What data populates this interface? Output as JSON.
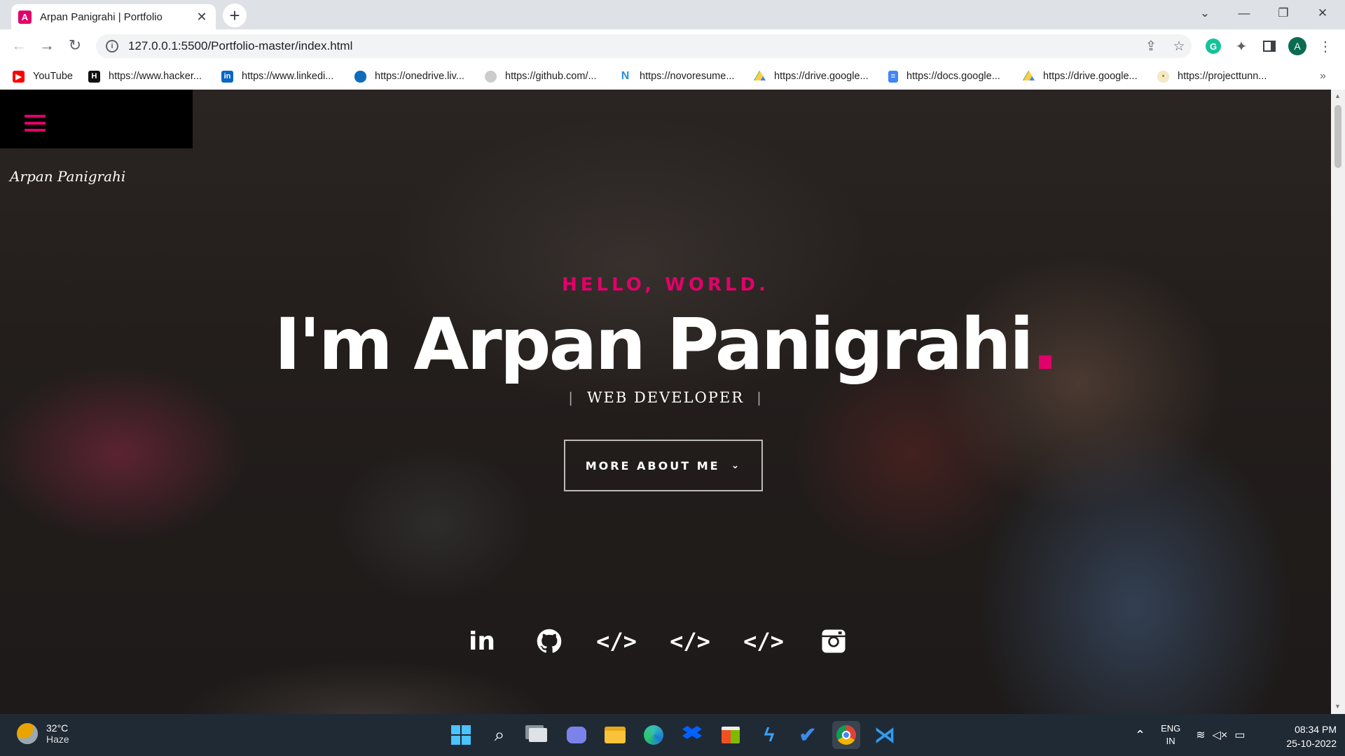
{
  "browser": {
    "tab_title": "Arpan Panigrahi | Portfolio",
    "tab_favicon": "A",
    "url": "127.0.0.1:5500/Portfolio-master/index.html",
    "profile_initial": "A",
    "bookmarks": [
      {
        "label": "YouTube",
        "icon": "youtube-icon"
      },
      {
        "label": "https://www.hacker...",
        "icon": "hackerrank-icon"
      },
      {
        "label": "https://www.linkedi...",
        "icon": "linkedin-icon"
      },
      {
        "label": "https://onedrive.liv...",
        "icon": "onedrive-icon"
      },
      {
        "label": "https://github.com/...",
        "icon": "github-icon"
      },
      {
        "label": "https://novoresume...",
        "icon": "novoresume-icon"
      },
      {
        "label": "https://drive.google...",
        "icon": "google-drive-icon"
      },
      {
        "label": "https://docs.google...",
        "icon": "google-docs-icon"
      },
      {
        "label": "https://drive.google...",
        "icon": "google-drive-icon"
      },
      {
        "label": "https://projecttunn...",
        "icon": "bulb-icon"
      }
    ]
  },
  "page": {
    "brand": "Arpan Panigrahi",
    "hello": "HELLO, WORLD.",
    "name": "I'm Arpan Panigrahi",
    "name_dot": ".",
    "role": "WEB DEVELOPER",
    "more_button": "MORE ABOUT ME",
    "social": [
      "linkedin-icon",
      "github-icon",
      "code-icon",
      "code-icon",
      "code-icon",
      "instagram-icon"
    ],
    "accent": "#e2006a"
  },
  "taskbar": {
    "temperature": "32°C",
    "weather": "Haze",
    "lang1": "ENG",
    "lang2": "IN",
    "time": "08:34 PM",
    "date": "25-10-2022"
  }
}
